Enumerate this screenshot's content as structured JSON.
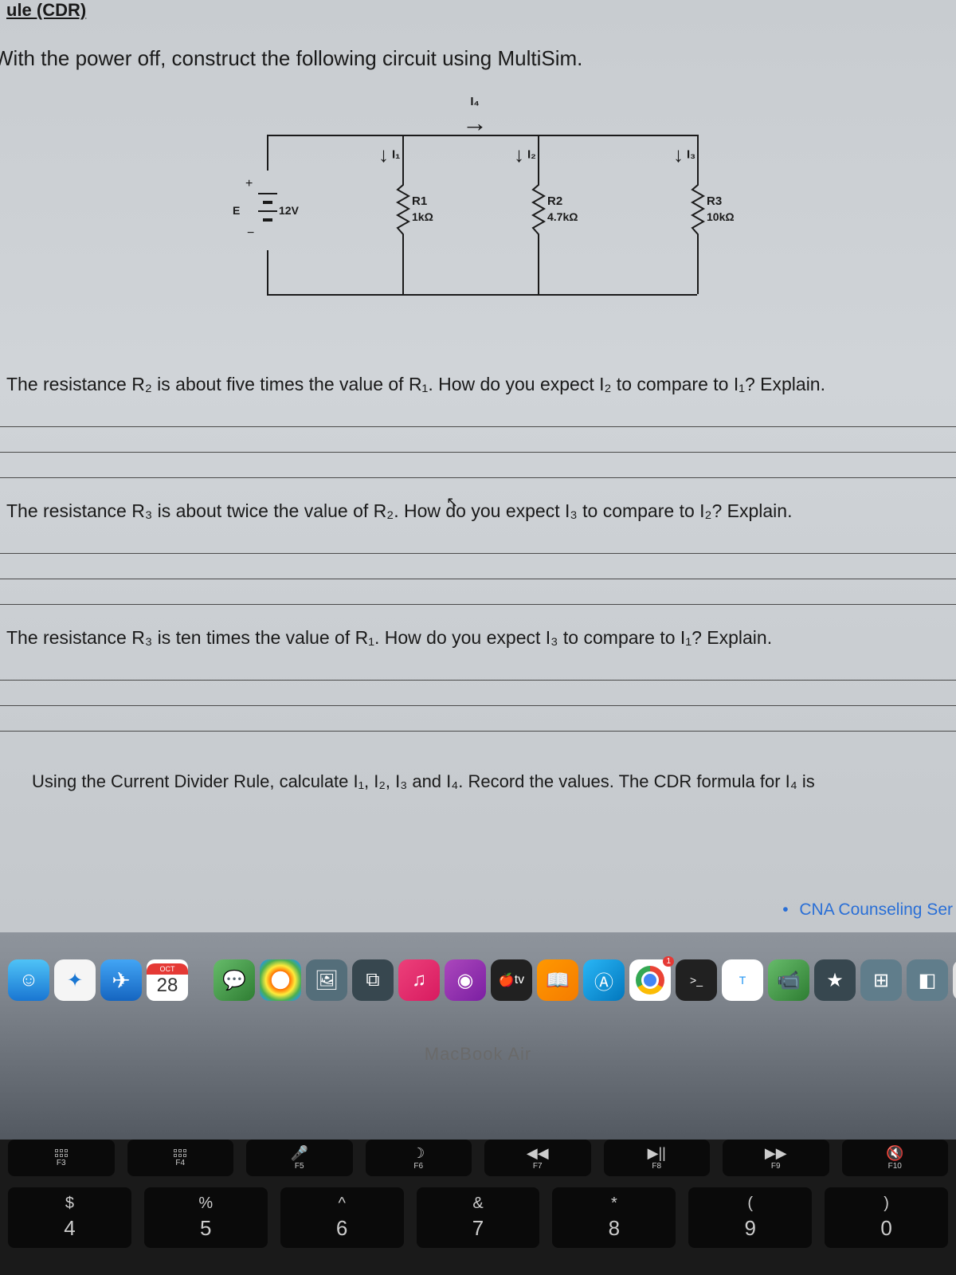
{
  "header_fragment": "ule (CDR)",
  "instruction": "With the power off, construct the following circuit using MultiSim.",
  "circuit": {
    "source_label": "E",
    "source_value": "12V",
    "branches": [
      {
        "name": "R1",
        "value": "1kΩ",
        "current": "I₁"
      },
      {
        "name": "R2",
        "value": "4.7kΩ",
        "current": "I₂"
      },
      {
        "name": "R3",
        "value": "10kΩ",
        "current": "I₃"
      }
    ],
    "total_current": "I₄"
  },
  "questions": {
    "q1": "The resistance R₂ is about five times the value of R₁. How do you expect I₂ to compare to I₁? Explain.",
    "q2": "The resistance R₃ is about twice the value of R₂. How do you expect I₃ to compare to I₂? Explain.",
    "q3": "The resistance R₃ is ten times the value of R₁. How do you expect I₃ to compare to I₁? Explain.",
    "q4": "Using the Current Divider Rule, calculate I₁, I₂, I₃ and I₄. Record the values. The CDR formula for I₄ is"
  },
  "notification": "CNA Counseling Ser",
  "dock": {
    "calendar": {
      "month": "OCT",
      "day": "28"
    },
    "tv_label": "tv",
    "terminal_prompt": ">_",
    "textedit_letter": "T",
    "chrome_badge": "1"
  },
  "macbook_label": "MacBook Air",
  "keyboard": {
    "fn_row": [
      {
        "icon_name": "mission-control-icon",
        "label": "F3"
      },
      {
        "icon_name": "spotlight-icon",
        "label": "F4"
      },
      {
        "icon_name": "dictation-icon",
        "label": "F5"
      },
      {
        "icon_name": "dnd-icon",
        "label": "F6"
      },
      {
        "icon_name": "rewind-icon",
        "label": "F7"
      },
      {
        "icon_name": "play-pause-icon",
        "label": "F8"
      },
      {
        "icon_name": "forward-icon",
        "label": "F9"
      },
      {
        "icon_name": "mute-icon",
        "label": "F10"
      }
    ],
    "num_row": [
      {
        "symbol": "$",
        "number": "4"
      },
      {
        "symbol": "%",
        "number": "5"
      },
      {
        "symbol": "^",
        "number": "6"
      },
      {
        "symbol": "&",
        "number": "7"
      },
      {
        "symbol": "*",
        "number": "8"
      },
      {
        "symbol": "(",
        "number": "9"
      },
      {
        "symbol": ")",
        "number": "0"
      }
    ]
  }
}
